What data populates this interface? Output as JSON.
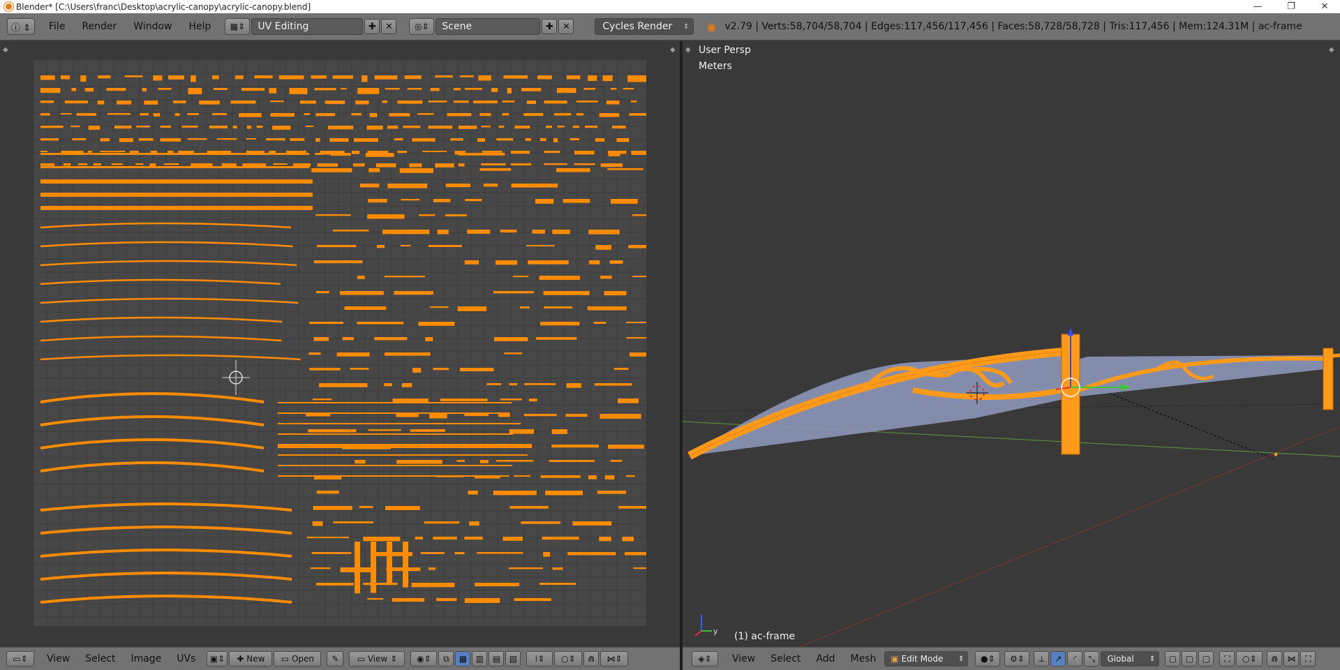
{
  "window": {
    "title": "Blender* [C:\\Users\\franc\\Desktop\\acrylic-canopy\\acrylic-canopy.blend]",
    "controls": [
      "—",
      "❐",
      "✕"
    ]
  },
  "info_header": {
    "menus": [
      "File",
      "Render",
      "Window",
      "Help"
    ],
    "screen_layout": "UV Editing",
    "scene": "Scene",
    "render_engine": "Cycles Render",
    "stats": "v2.79 | Verts:58,704/58,704 | Edges:117,456/117,456 | Faces:58,728/58,728 | Tris:117,456 | Mem:124.31M | ac-frame"
  },
  "viewport": {
    "view_name": "User Persp",
    "units": "Meters",
    "object_label": "(1) ac-frame",
    "axis_y": "y"
  },
  "uv_footer": {
    "menus": [
      "View",
      "Select",
      "Image",
      "UVs"
    ],
    "new_label": "New",
    "open_label": "Open",
    "view_label": "View"
  },
  "vp_footer": {
    "menus": [
      "View",
      "Select",
      "Add",
      "Mesh"
    ],
    "mode": "Edit Mode",
    "orientation": "Global"
  },
  "colors": {
    "uv_island": "#ff8c00",
    "mesh_wire": "#ff9a1a",
    "acrylic": "#8d96b8",
    "header_bg": "#727272",
    "editor_bg": "#393939"
  }
}
